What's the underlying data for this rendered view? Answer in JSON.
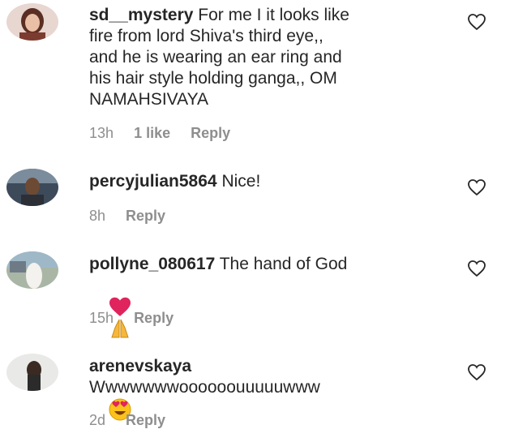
{
  "comments": [
    {
      "username": "sd__mystery",
      "text": "For me I it looks like\nfire from lord Shiva's third eye,,\nand he is wearing an ear ring and\nhis hair style holding ganga,, OM\nNAMAHSIVAYA",
      "time": "13h",
      "likes": "1 like",
      "reply": "Reply"
    },
    {
      "username": "percyjulian5864",
      "text": "Nice!",
      "time": "8h",
      "reply": "Reply"
    },
    {
      "username": "pollyne_080617",
      "text": "The hand of God",
      "emojis": [
        "red-heart",
        "folded-hands"
      ],
      "time": "15h",
      "reply": "Reply"
    },
    {
      "username": "arenevskaya",
      "text": "Wwwwwwwoooooouuuuuwww",
      "emojis": [
        "heart-eyes-face"
      ],
      "time": "2d",
      "reply": "Reply"
    }
  ],
  "icons": {
    "like": "heart-outline-icon"
  },
  "colors": {
    "text": "#262626",
    "meta": "#8e8e8e",
    "heart": "#e0245e"
  }
}
